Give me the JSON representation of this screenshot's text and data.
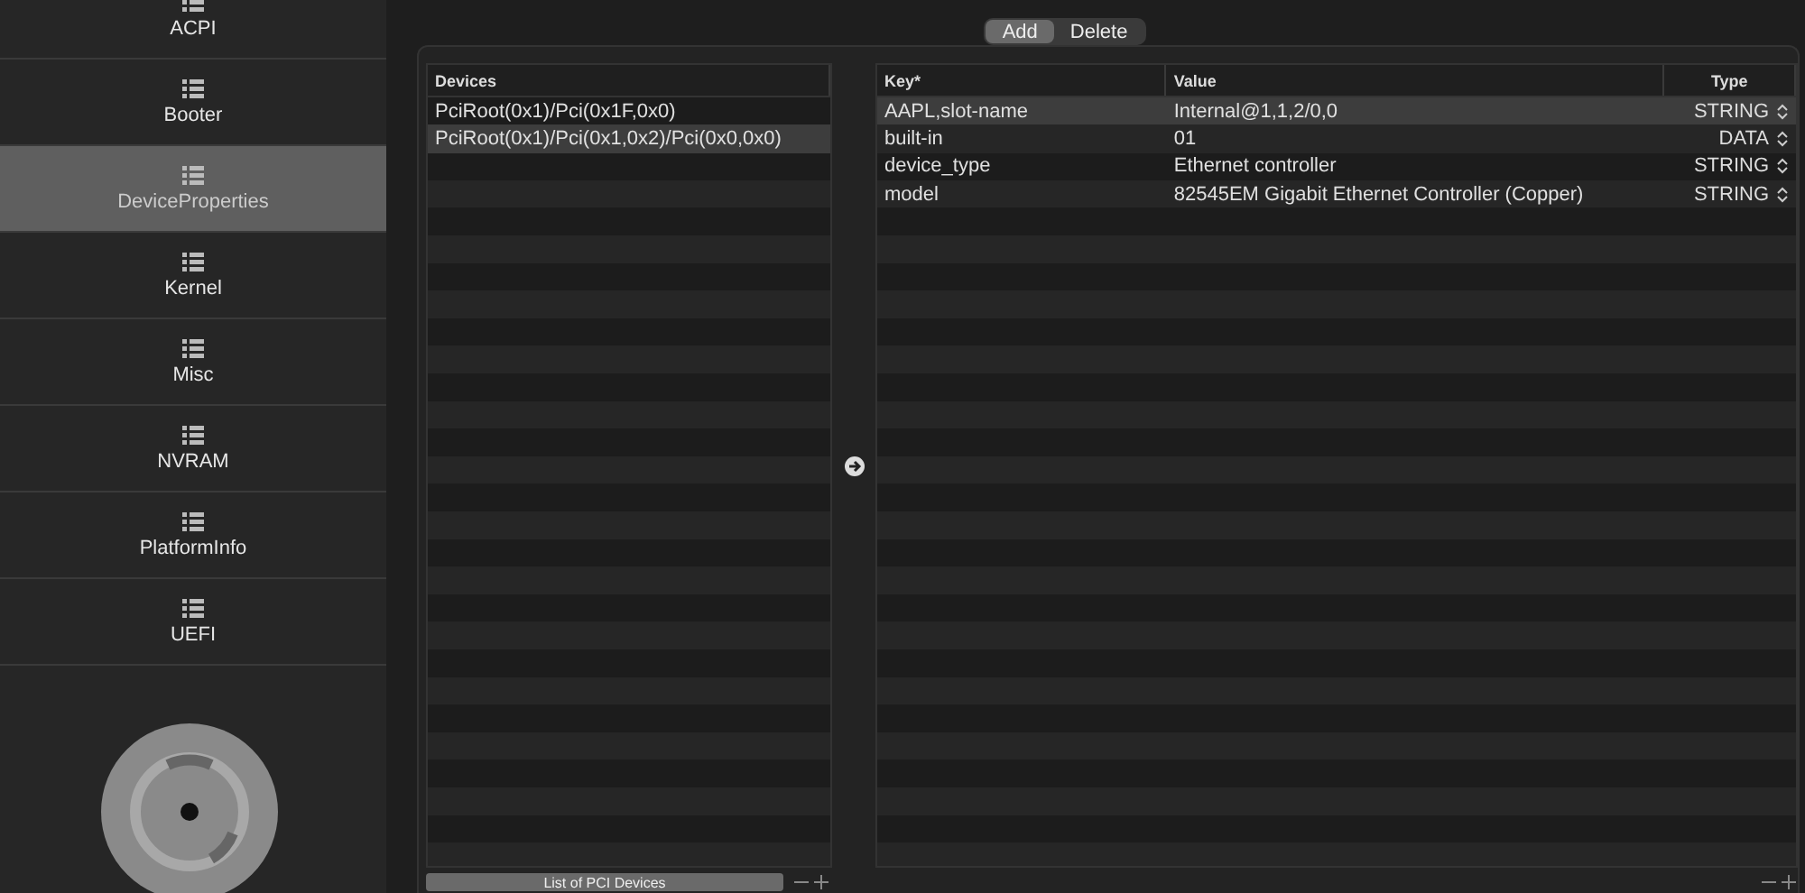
{
  "sidebar": {
    "items": [
      {
        "label": "ACPI",
        "selected": false
      },
      {
        "label": "Booter",
        "selected": false
      },
      {
        "label": "DeviceProperties",
        "selected": true
      },
      {
        "label": "Kernel",
        "selected": false
      },
      {
        "label": "Misc",
        "selected": false
      },
      {
        "label": "NVRAM",
        "selected": false
      },
      {
        "label": "PlatformInfo",
        "selected": false
      },
      {
        "label": "UEFI",
        "selected": false
      }
    ]
  },
  "segments": [
    {
      "label": "Add",
      "selected": true
    },
    {
      "label": "Delete",
      "selected": false
    }
  ],
  "devices": {
    "column": "Devices",
    "rows": [
      {
        "path": "PciRoot(0x1)/Pci(0x1F,0x0)",
        "selected": false
      },
      {
        "path": "PciRoot(0x1)/Pci(0x1,0x2)/Pci(0x0,0x0)",
        "selected": true
      }
    ],
    "popup": "List of PCI Devices"
  },
  "properties": {
    "columns": [
      "Key*",
      "Value",
      "Type"
    ],
    "rows": [
      {
        "key": "AAPL,slot-name",
        "value": "Internal@1,1,2/0,0",
        "type": "STRING",
        "selected": true
      },
      {
        "key": "built-in",
        "value": "01",
        "type": "DATA",
        "selected": false
      },
      {
        "key": "device_type",
        "value": "Ethernet controller",
        "type": "STRING",
        "selected": false
      },
      {
        "key": "model",
        "value": "82545EM Gigabit Ethernet Controller (Copper)",
        "type": "STRING",
        "selected": false
      }
    ]
  }
}
